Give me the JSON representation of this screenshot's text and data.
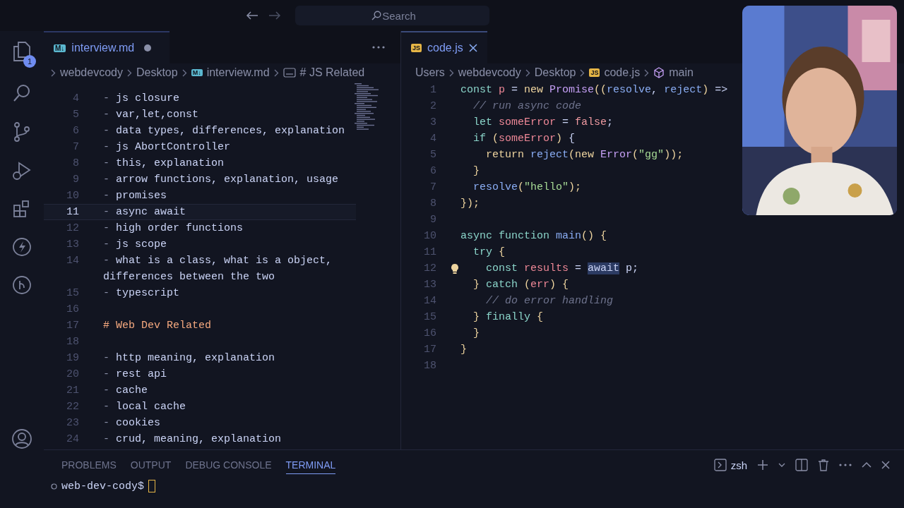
{
  "title_bar": {
    "search": {
      "placeholder": "Search"
    }
  },
  "activity_bar": {
    "explorer_badge": "1"
  },
  "left_editor": {
    "tab": {
      "icon_text": "M↓",
      "label": "interview.md",
      "modified": true
    },
    "breadcrumbs": [
      {
        "label": "webdevcody",
        "kind": "folder"
      },
      {
        "label": "Desktop",
        "kind": "folder"
      },
      {
        "label": "interview.md",
        "kind": "file",
        "icon_text": "M↓"
      },
      {
        "label": "# JS Related",
        "kind": "symbol"
      }
    ],
    "lines": [
      {
        "number": "4",
        "kind": "item",
        "marker": "-",
        "text": "js closure",
        "current": false
      },
      {
        "number": "5",
        "kind": "item",
        "marker": "-",
        "text": "var,let,const",
        "current": false
      },
      {
        "number": "6",
        "kind": "item",
        "marker": "-",
        "text": "data types, differences, explanation",
        "current": false
      },
      {
        "number": "7",
        "kind": "item",
        "marker": "-",
        "text": "js AbortController",
        "current": false
      },
      {
        "number": "8",
        "kind": "item",
        "marker": "-",
        "text": "this, explanation",
        "current": false
      },
      {
        "number": "9",
        "kind": "item",
        "marker": "-",
        "text": "arrow functions, explanation, usage",
        "current": false
      },
      {
        "number": "10",
        "kind": "item",
        "marker": "-",
        "text": "promises",
        "current": false
      },
      {
        "number": "11",
        "kind": "item",
        "marker": "-",
        "text": "async await",
        "current": true
      },
      {
        "number": "12",
        "kind": "item",
        "marker": "-",
        "text": "high order functions",
        "current": false
      },
      {
        "number": "13",
        "kind": "item",
        "marker": "-",
        "text": "js scope",
        "current": false
      },
      {
        "number": "14",
        "kind": "item",
        "marker": "-",
        "text": "what is a class, what is a object,",
        "wrapped": "differences between the two",
        "current": false
      },
      {
        "number": "15",
        "kind": "item",
        "marker": "-",
        "text": "typescript",
        "current": false
      },
      {
        "number": "16",
        "kind": "blank",
        "current": false
      },
      {
        "number": "17",
        "kind": "heading",
        "text": "# Web Dev Related",
        "current": false
      },
      {
        "number": "18",
        "kind": "blank",
        "current": false
      },
      {
        "number": "19",
        "kind": "item",
        "marker": "-",
        "text": "http meaning, explanation",
        "current": false
      },
      {
        "number": "20",
        "kind": "item",
        "marker": "-",
        "text": "rest api",
        "current": false
      },
      {
        "number": "21",
        "kind": "item",
        "marker": "-",
        "text": "cache",
        "current": false
      },
      {
        "number": "22",
        "kind": "item",
        "marker": "-",
        "text": "local cache",
        "current": false
      },
      {
        "number": "23",
        "kind": "item",
        "marker": "-",
        "text": "cookies",
        "current": false
      },
      {
        "number": "24",
        "kind": "item",
        "marker": "-",
        "text": "crud, meaning, explanation",
        "current": false
      }
    ]
  },
  "right_editor": {
    "tab": {
      "icon_text": "JS",
      "label": "code.js"
    },
    "breadcrumbs": [
      {
        "label": "Users",
        "kind": "folder"
      },
      {
        "label": "webdevcody",
        "kind": "folder"
      },
      {
        "label": "Desktop",
        "kind": "folder"
      },
      {
        "label": "code.js",
        "kind": "file",
        "icon_text": "JS"
      },
      {
        "label": "main",
        "kind": "symbol"
      }
    ],
    "lines": [
      {
        "number": "1",
        "lightbulb": false,
        "tokens": [
          {
            "kind": "keyword",
            "text": "const "
          },
          {
            "kind": "variable",
            "text": "p"
          },
          {
            "kind": "plain",
            "text": " = "
          },
          {
            "kind": "control",
            "text": "new "
          },
          {
            "kind": "type",
            "text": "Promise"
          },
          {
            "kind": "punct",
            "text": "(("
          },
          {
            "kind": "param",
            "text": "resolve"
          },
          {
            "kind": "plain",
            "text": ", "
          },
          {
            "kind": "param",
            "text": "reject"
          },
          {
            "kind": "punct",
            "text": ")"
          },
          {
            "kind": "plain",
            "text": " =>"
          }
        ]
      },
      {
        "number": "2",
        "lightbulb": false,
        "tokens": [
          {
            "kind": "comment",
            "text": "  // run async code"
          }
        ]
      },
      {
        "number": "3",
        "lightbulb": false,
        "tokens": [
          {
            "kind": "keyword",
            "text": "  let "
          },
          {
            "kind": "variable",
            "text": "someError"
          },
          {
            "kind": "plain",
            "text": " = "
          },
          {
            "kind": "boolean",
            "text": "false"
          },
          {
            "kind": "plain",
            "text": ";"
          }
        ]
      },
      {
        "number": "4",
        "lightbulb": false,
        "tokens": [
          {
            "kind": "keyword",
            "text": "  if "
          },
          {
            "kind": "punct",
            "text": "("
          },
          {
            "kind": "variable",
            "text": "someError"
          },
          {
            "kind": "punct",
            "text": ")"
          },
          {
            "kind": "plain",
            "text": " {"
          }
        ]
      },
      {
        "number": "5",
        "lightbulb": false,
        "tokens": [
          {
            "kind": "control",
            "text": "    return "
          },
          {
            "kind": "param",
            "text": "reject"
          },
          {
            "kind": "punct",
            "text": "("
          },
          {
            "kind": "control",
            "text": "new "
          },
          {
            "kind": "type",
            "text": "Error"
          },
          {
            "kind": "punct",
            "text": "("
          },
          {
            "kind": "string",
            "text": "\"gg\""
          },
          {
            "kind": "punct",
            "text": "));"
          }
        ]
      },
      {
        "number": "6",
        "lightbulb": false,
        "tokens": [
          {
            "kind": "punct",
            "text": "  }"
          }
        ]
      },
      {
        "number": "7",
        "lightbulb": false,
        "tokens": [
          {
            "kind": "param",
            "text": "  resolve"
          },
          {
            "kind": "punct",
            "text": "("
          },
          {
            "kind": "string",
            "text": "\"hello\""
          },
          {
            "kind": "punct",
            "text": ");"
          }
        ]
      },
      {
        "number": "8",
        "lightbulb": false,
        "tokens": [
          {
            "kind": "punct",
            "text": "});"
          }
        ]
      },
      {
        "number": "9",
        "lightbulb": false
      },
      {
        "number": "10",
        "lightbulb": false,
        "tokens": [
          {
            "kind": "keyword",
            "text": "async "
          },
          {
            "kind": "keyword",
            "text": "function "
          },
          {
            "kind": "param",
            "text": "main"
          },
          {
            "kind": "punct",
            "text": "() {"
          }
        ]
      },
      {
        "number": "11",
        "lightbulb": false,
        "tokens": [
          {
            "kind": "keyword",
            "text": "  try "
          },
          {
            "kind": "punct",
            "text": "{"
          }
        ]
      },
      {
        "number": "12",
        "lightbulb": true,
        "tokens": [
          {
            "kind": "keyword",
            "text": "    const "
          },
          {
            "kind": "variable",
            "text": "results"
          },
          {
            "kind": "plain",
            "text": " = "
          },
          {
            "kind": "selection",
            "text": "await"
          },
          {
            "kind": "plain",
            "text": " p;"
          }
        ]
      },
      {
        "number": "13",
        "lightbulb": false,
        "tokens": [
          {
            "kind": "punct",
            "text": "  } "
          },
          {
            "kind": "keyword",
            "text": "catch "
          },
          {
            "kind": "punct",
            "text": "("
          },
          {
            "kind": "variable",
            "text": "err"
          },
          {
            "kind": "punct",
            "text": ") {"
          }
        ]
      },
      {
        "number": "14",
        "lightbulb": false,
        "tokens": [
          {
            "kind": "comment",
            "text": "    // do error handling"
          }
        ]
      },
      {
        "number": "15",
        "lightbulb": false,
        "tokens": [
          {
            "kind": "punct",
            "text": "  } "
          },
          {
            "kind": "keyword",
            "text": "finally "
          },
          {
            "kind": "punct",
            "text": "{"
          }
        ]
      },
      {
        "number": "16",
        "lightbulb": false,
        "tokens": [
          {
            "kind": "punct",
            "text": "  }"
          }
        ]
      },
      {
        "number": "17",
        "lightbulb": false,
        "tokens": [
          {
            "kind": "punct",
            "text": "}"
          }
        ]
      },
      {
        "number": "18",
        "lightbulb": false
      }
    ]
  },
  "panel": {
    "tabs": [
      {
        "label": "PROBLEMS",
        "selected": false
      },
      {
        "label": "OUTPUT",
        "selected": false
      },
      {
        "label": "DEBUG CONSOLE",
        "selected": false
      },
      {
        "label": "TERMINAL",
        "selected": true
      }
    ],
    "shell": "zsh",
    "prompt": "web-dev-cody$"
  }
}
